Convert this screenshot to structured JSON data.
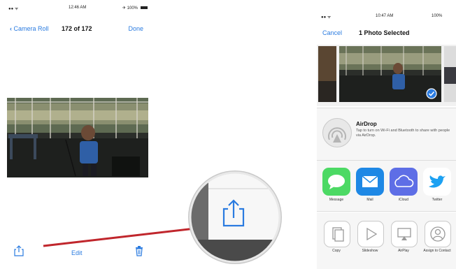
{
  "left": {
    "status": {
      "carrier": "●● ᯤ",
      "time": "12:46 AM",
      "battery": "✈ 100%"
    },
    "nav": {
      "back_label": "Camera Roll",
      "counter": "172 of 172",
      "done_label": "Done"
    },
    "toolbar": {
      "edit_label": "Edit"
    }
  },
  "right": {
    "status": {
      "carrier": "●● ᯤ",
      "time": "10:47 AM",
      "battery": "100%"
    },
    "nav": {
      "cancel_label": "Cancel",
      "title": "1 Photo Selected"
    },
    "airdrop": {
      "title": "AirDrop",
      "description": "Tap to turn on Wi-Fi and Bluetooth to share with people via AirDrop."
    },
    "apps": [
      {
        "label": "Message",
        "icon": "message-icon",
        "color": "#4cd964"
      },
      {
        "label": "Mail",
        "icon": "mail-icon",
        "color": "#1e88e5"
      },
      {
        "label": "iCloud",
        "icon": "icloud-icon",
        "color": "#5e6ee6"
      },
      {
        "label": "Twitter",
        "icon": "twitter-icon",
        "color": "#1da1f2"
      }
    ],
    "actions": [
      {
        "label": "Copy",
        "icon": "copy-icon"
      },
      {
        "label": "Slideshow",
        "icon": "slideshow-icon"
      },
      {
        "label": "AirPlay",
        "icon": "airplay-icon"
      },
      {
        "label": "Assign to Contact",
        "icon": "contact-icon"
      }
    ]
  },
  "colors": {
    "ios_blue": "#2a7be0",
    "arrow_red": "#c0262c"
  }
}
